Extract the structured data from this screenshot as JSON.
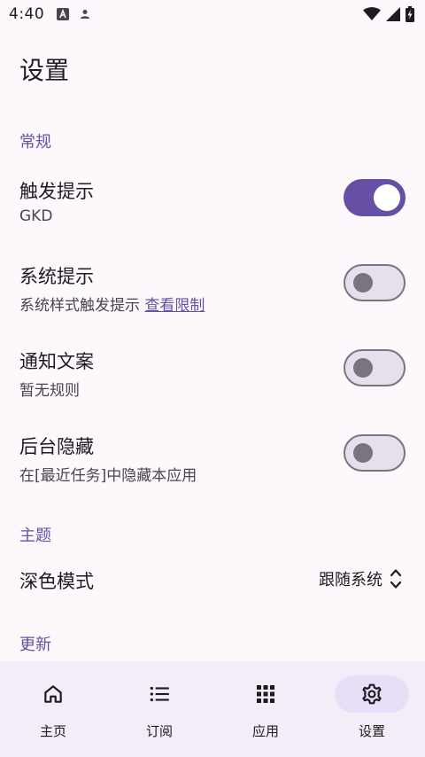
{
  "status_bar": {
    "time": "4:40"
  },
  "page": {
    "title": "设置"
  },
  "sections": {
    "general": "常规",
    "theme": "主题",
    "update": "更新"
  },
  "settings": [
    {
      "title": "触发提示",
      "subtitle": "GKD",
      "enabled": true
    },
    {
      "title": "系统提示",
      "subtitle": "系统样式触发提示",
      "link": "查看限制",
      "enabled": false
    },
    {
      "title": "通知文案",
      "subtitle": "暂无规则",
      "enabled": false
    },
    {
      "title": "后台隐藏",
      "subtitle": "在[最近任务]中隐藏本应用",
      "enabled": false
    }
  ],
  "dark_mode": {
    "label": "深色模式",
    "value": "跟随系统"
  },
  "nav": {
    "items": [
      {
        "label": "主页",
        "icon": "home-icon"
      },
      {
        "label": "订阅",
        "icon": "list-icon"
      },
      {
        "label": "应用",
        "icon": "apps-grid-icon"
      },
      {
        "label": "设置",
        "icon": "gear-icon"
      }
    ],
    "active_index": 3
  },
  "colors": {
    "accent": "#6750a4",
    "background": "#fdf8fc",
    "nav_background": "#f3edf7",
    "nav_active_pill": "#e8def8"
  }
}
